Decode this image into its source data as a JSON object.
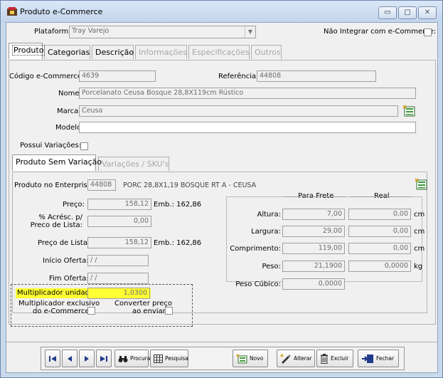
{
  "window": {
    "title": "Produto e-Commerce",
    "minimize_glyph": "▭",
    "maximize_glyph": "▢",
    "close_glyph": "✕"
  },
  "header": {
    "plataforma_label": "Plataforma:",
    "plataforma_value": "Tray Varejo",
    "nao_integrar_label": "Não Integrar com e-Commerce:"
  },
  "tabs": [
    {
      "label": "Produto",
      "state": "active"
    },
    {
      "label": "Categorias",
      "state": "enabled"
    },
    {
      "label": "Descrição",
      "state": "enabled"
    },
    {
      "label": "Informações",
      "state": "disabled"
    },
    {
      "label": "Especificações",
      "state": "disabled"
    },
    {
      "label": "Outros",
      "state": "disabled"
    }
  ],
  "produto": {
    "codigo_label": "Código e-Commerce:",
    "codigo_value": "4639",
    "referencia_label": "Referência:",
    "referencia_value": "44808",
    "nome_label": "Nome:",
    "nome_value": "Porcelanato Ceusa Bosque 28,8X119cm Rústico",
    "marca_label": "Marca:",
    "marca_value": "Ceusa",
    "modelo_label": "Modelo:",
    "modelo_value": "",
    "possui_variacoes_label": "Possui Variações:"
  },
  "subtabs": [
    {
      "label": "Produto Sem Variação",
      "state": "active"
    },
    {
      "label": "Variações / SKU's",
      "state": "disabled"
    }
  ],
  "sem_variacao": {
    "enterprise_label": "Produto no Enterprise:",
    "enterprise_code": "44808",
    "enterprise_desc": "PORC 28,8X1,19 BOSQUE RT A - CEUSA",
    "preco_label": "Preço:",
    "preco_value": "158,12",
    "preco_emb": "Emb.: 162,86",
    "acresc_label_1": "% Acrésc. p/",
    "acresc_label_2": "Preco de Lista:",
    "acresc_value": "0,00",
    "preco_lista_label": "Preço de Lista:",
    "preco_lista_value": "158,12",
    "preco_lista_emb": "Emb.: 162,86",
    "inicio_label": "Início Oferta:",
    "inicio_value": "/ /",
    "fim_label": "Fim Oferta:",
    "fim_value": "/ /",
    "multiplicador_label": "Multiplicador unidade:",
    "multiplicador_value": "1,0300",
    "mult_excl_label_1": "Multiplicador exclusivo",
    "mult_excl_label_2": "do e-Commerce:",
    "converter_label_1": "Converter preço",
    "converter_label_2": "ao enviar:"
  },
  "dimensions": {
    "col_frete": "Para Frete",
    "col_real": "Real",
    "rows": [
      {
        "label": "Altura:",
        "frete": "7,00",
        "real": "0,00",
        "unit": "cm"
      },
      {
        "label": "Largura:",
        "frete": "29,00",
        "real": "0,00",
        "unit": "cm"
      },
      {
        "label": "Comprimento:",
        "frete": "119,00",
        "real": "0,00",
        "unit": "cm"
      },
      {
        "label": "Peso:",
        "frete": "21,1900",
        "real": "0,0000",
        "unit": "kg"
      }
    ],
    "peso_cubico_label": "Peso Cúbico:",
    "peso_cubico_value": "0,0000"
  },
  "toolbar": {
    "procurar": "Procurar",
    "pesquisa": "Pesquisa",
    "novo": "Novo",
    "alterar": "Alterar",
    "excluir": "Excluir",
    "fechar": "Fechar"
  },
  "colors": {
    "highlight": "#ffff33",
    "title_bar": "#c9d9ec"
  }
}
